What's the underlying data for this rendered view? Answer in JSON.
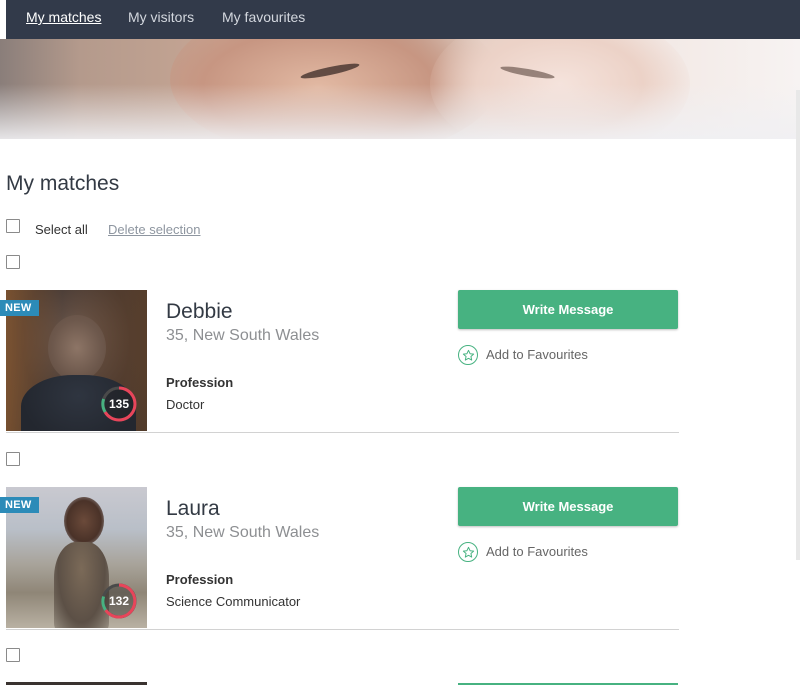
{
  "nav": {
    "items": [
      {
        "label": "My matches",
        "active": true
      },
      {
        "label": "My visitors",
        "active": false
      },
      {
        "label": "My favourites",
        "active": false
      }
    ]
  },
  "page_title": "My matches",
  "toolbar": {
    "select_all_label": "Select all",
    "delete_selection_label": "Delete selection"
  },
  "matches": [
    {
      "badge": "NEW",
      "score": "135",
      "name": "Debbie",
      "subtitle": "35, New South Wales",
      "profession_label": "Profession",
      "profession": "Doctor",
      "write_label": "Write Message",
      "fav_label": "Add to Favourites"
    },
    {
      "badge": "NEW",
      "score": "132",
      "name": "Laura",
      "subtitle": "35, New South Wales",
      "profession_label": "Profession",
      "profession": "Science Communicator",
      "write_label": "Write Message",
      "fav_label": "Add to Favourites"
    }
  ],
  "colors": {
    "nav_bg": "#323a4a",
    "accent_green": "#47b281",
    "badge_blue": "#2c8bb8",
    "score_ring_red": "#e8455a"
  }
}
